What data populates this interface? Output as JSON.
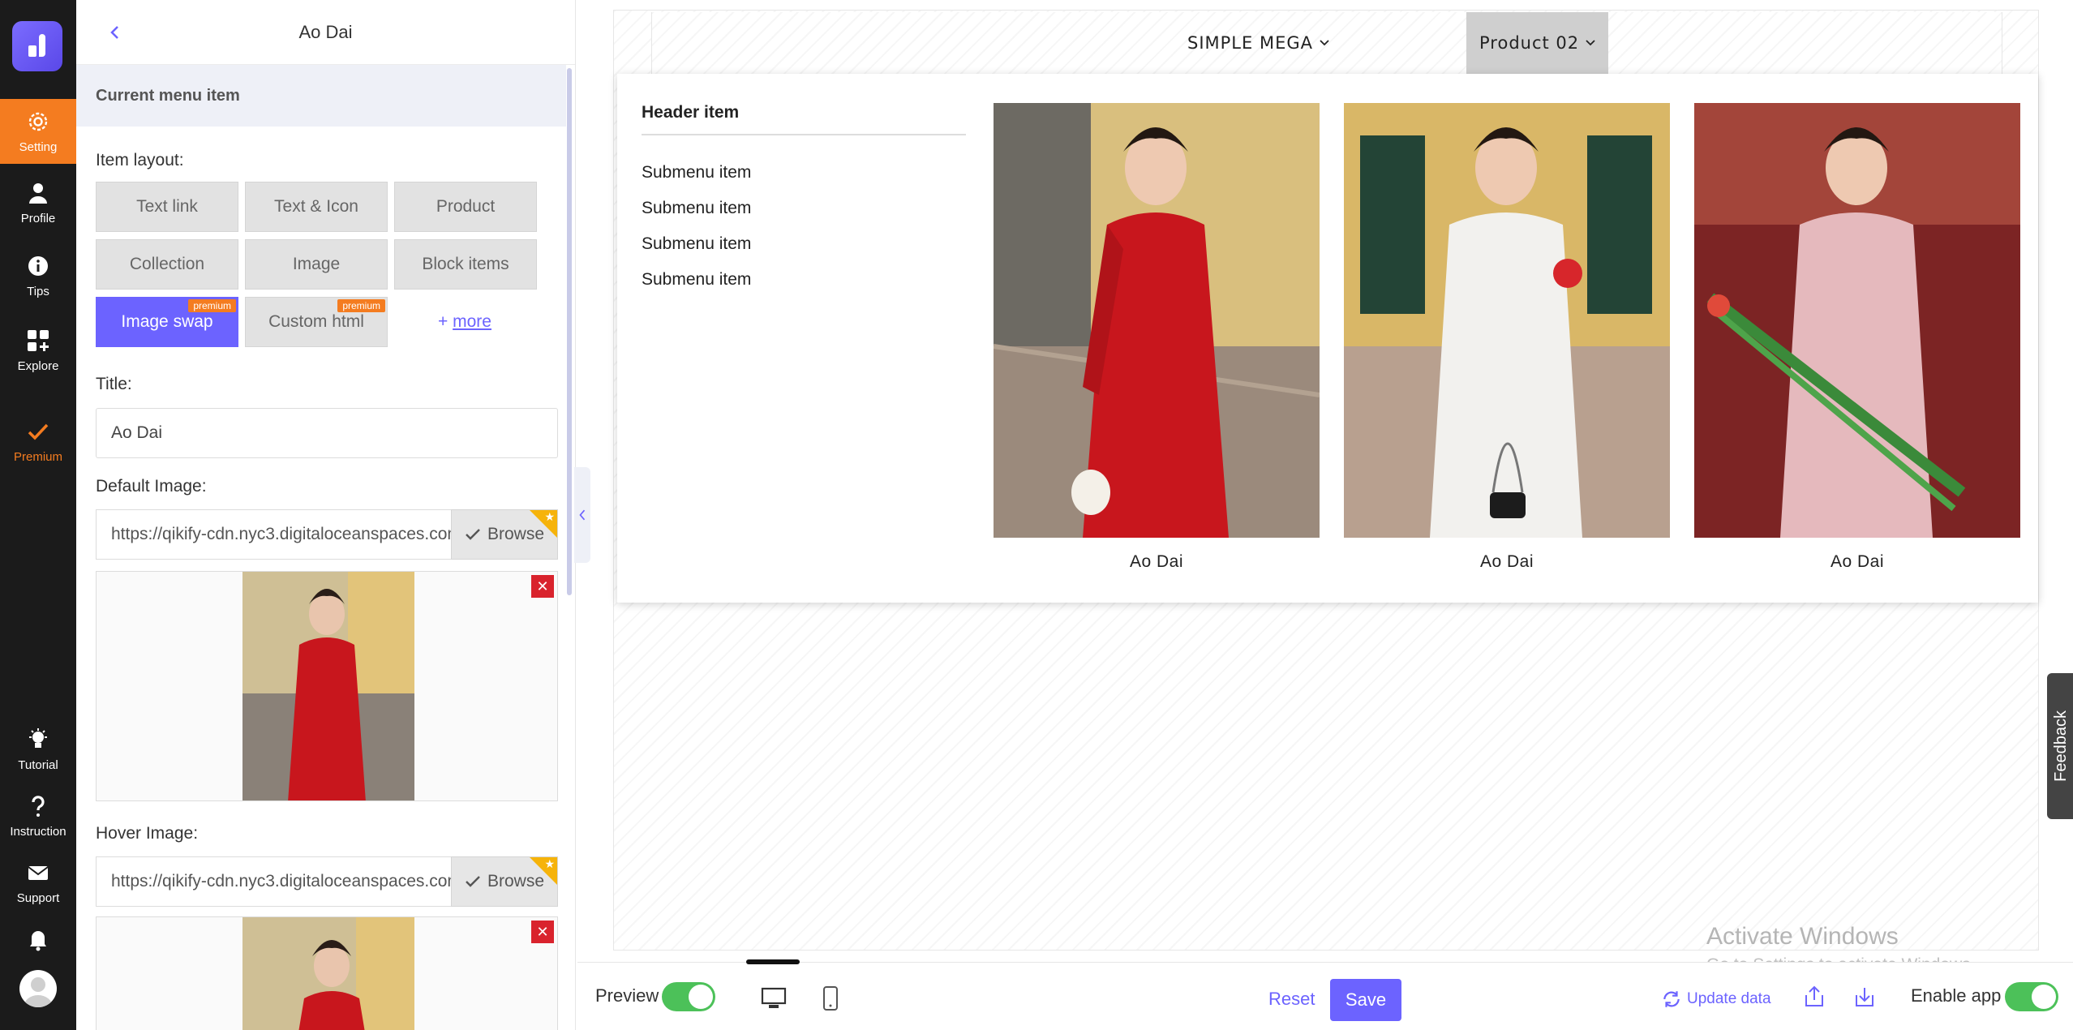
{
  "rail": {
    "items": [
      {
        "label": "Setting",
        "icon": "gear-icon"
      },
      {
        "label": "Profile",
        "icon": "user-icon"
      },
      {
        "label": "Tips",
        "icon": "info-icon"
      },
      {
        "label": "Explore",
        "icon": "grid-plus-icon"
      },
      {
        "label": "Premium",
        "icon": "check-icon"
      },
      {
        "label": "Tutorial",
        "icon": "bulb-icon"
      },
      {
        "label": "Instruction",
        "icon": "question-icon"
      },
      {
        "label": "Support",
        "icon": "mail-icon"
      }
    ]
  },
  "panel": {
    "title": "Ao Dai",
    "section": "Current menu item",
    "item_layout_label": "Item layout:",
    "layouts": [
      "Text link",
      "Text & Icon",
      "Product",
      "Collection",
      "Image",
      "Block items",
      "Image swap",
      "Custom html"
    ],
    "premium_badge": "premium",
    "more_prefix": "+ ",
    "more_label": "more",
    "title_label": "Title:",
    "title_value": "Ao Dai",
    "default_image_label": "Default Image:",
    "default_image_url": "https://qikify-cdn.nyc3.digitaloceanspaces.com",
    "hover_image_label": "Hover Image:",
    "hover_image_url": "https://qikify-cdn.nyc3.digitaloceanspaces.com",
    "browse_label": "Browse"
  },
  "canvas": {
    "nav": [
      {
        "label": "SIMPLE MEGA"
      },
      {
        "label": "Product 02"
      }
    ],
    "mega": {
      "header": "Header item",
      "submenu": [
        "Submenu item",
        "Submenu item",
        "Submenu item",
        "Submenu item"
      ],
      "products": [
        {
          "caption": "Ao Dai",
          "color": "#c8161d"
        },
        {
          "caption": "Ao Dai",
          "color": "#f2f1ee"
        },
        {
          "caption": "Ao Dai",
          "color": "#e5b9bd"
        }
      ]
    },
    "watermark_title": "Activate Windows",
    "watermark_sub": "Go to Settings to activate Windows."
  },
  "feedback_label": "Feedback",
  "bottom": {
    "preview_label": "Preview",
    "reset_label": "Reset",
    "save_label": "Save",
    "update_label": "Update data",
    "enable_label": "Enable app"
  },
  "colors": {
    "accent": "#6c63ff",
    "orange": "#f47c20",
    "toggle": "#4cc159"
  }
}
